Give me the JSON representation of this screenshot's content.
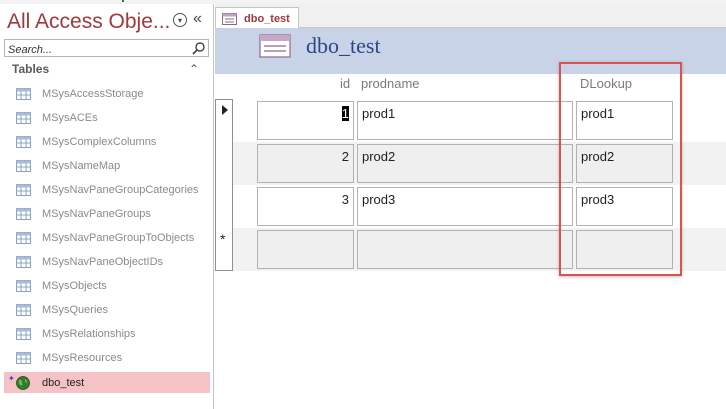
{
  "nav": {
    "title": "All Access Obje...",
    "search_placeholder": "Search...",
    "group_header": "Tables",
    "items": [
      {
        "label": "MSysAccessStorage"
      },
      {
        "label": "MSysACEs"
      },
      {
        "label": "MSysComplexColumns"
      },
      {
        "label": "MSysNameMap"
      },
      {
        "label": "MSysNavPaneGroupCategories"
      },
      {
        "label": "MSysNavPaneGroups"
      },
      {
        "label": "MSysNavPaneGroupToObjects"
      },
      {
        "label": "MSysNavPaneObjectIDs"
      },
      {
        "label": "MSysObjects"
      },
      {
        "label": "MSysQueries"
      },
      {
        "label": "MSysRelationships"
      },
      {
        "label": "MSysResources"
      }
    ],
    "selected_item": {
      "label": "dbo_test",
      "icon": "globe-icon"
    }
  },
  "doc": {
    "tab_label": "dbo_test",
    "form_title": "dbo_test",
    "columns": {
      "id": "id",
      "prodname": "prodname",
      "dlookup": "DLookup"
    },
    "rows": [
      {
        "id": "1",
        "prodname": "prod1",
        "dlookup": "prod1"
      },
      {
        "id": "2",
        "prodname": "prod2",
        "dlookup": "prod2"
      },
      {
        "id": "3",
        "prodname": "prod3",
        "dlookup": "prod3"
      }
    ],
    "new_record_marker": "*"
  },
  "colors": {
    "accent": "#a4373a",
    "form_header_bg": "#c8d3e8",
    "selected_nav_bg": "#f5c3c6",
    "highlight_border": "#d9534f"
  }
}
